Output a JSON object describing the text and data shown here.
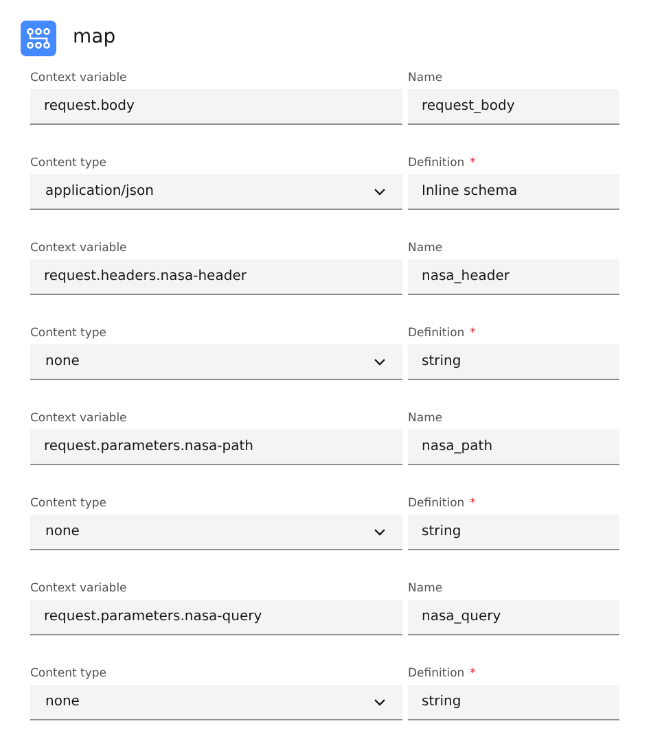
{
  "header": {
    "title": "map"
  },
  "rows": [
    {
      "fields": [
        {
          "kind": "input",
          "label": "Context variable",
          "value": "request.body"
        },
        {
          "kind": "input",
          "label": "Name",
          "value": "request_body"
        }
      ]
    },
    {
      "fields": [
        {
          "kind": "select",
          "label": "Content type",
          "value": "application/json"
        },
        {
          "kind": "input",
          "label": "Definition",
          "required_mark": "*",
          "value": "Inline schema"
        }
      ]
    },
    {
      "fields": [
        {
          "kind": "input",
          "label": "Context variable",
          "value": "request.headers.nasa-header"
        },
        {
          "kind": "input",
          "label": "Name",
          "value": "nasa_header"
        }
      ]
    },
    {
      "fields": [
        {
          "kind": "select",
          "label": "Content type",
          "value": "none"
        },
        {
          "kind": "input",
          "label": "Definition",
          "required_mark": "*",
          "value": "string"
        }
      ]
    },
    {
      "fields": [
        {
          "kind": "input",
          "label": "Context variable",
          "value": "request.parameters.nasa-path"
        },
        {
          "kind": "input",
          "label": "Name",
          "value": "nasa_path"
        }
      ]
    },
    {
      "fields": [
        {
          "kind": "select",
          "label": "Content type",
          "value": "none"
        },
        {
          "kind": "input",
          "label": "Definition",
          "required_mark": "*",
          "value": "string"
        }
      ]
    },
    {
      "fields": [
        {
          "kind": "input",
          "label": "Context variable",
          "value": "request.parameters.nasa-query"
        },
        {
          "kind": "input",
          "label": "Name",
          "value": "nasa_query"
        }
      ]
    },
    {
      "fields": [
        {
          "kind": "select",
          "label": "Content type",
          "value": "none"
        },
        {
          "kind": "input",
          "label": "Definition",
          "required_mark": "*",
          "value": "string"
        }
      ]
    }
  ]
}
